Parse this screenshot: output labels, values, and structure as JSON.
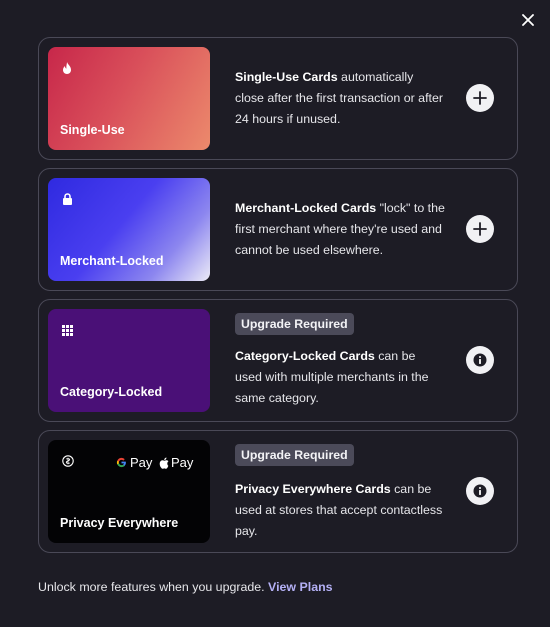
{
  "close_label": "close",
  "cards": [
    {
      "card_label": "Single-Use",
      "title": "Single-Use Cards",
      "description": " automatically close after the first transaction or after 24 hours if unused.",
      "icon": "flame-icon",
      "action": "add-icon"
    },
    {
      "card_label": "Merchant-Locked",
      "title": "Merchant-Locked Cards",
      "description": " \"lock\" to the first merchant where they're used and cannot be used elsewhere.",
      "icon": "lock-icon",
      "action": "add-icon"
    },
    {
      "card_label": "Category-Locked",
      "badge": "Upgrade Required",
      "title": "Category-Locked Cards",
      "description": " can be used with multiple merchants in the same category.",
      "icon": "grid-icon",
      "action": "info-icon"
    },
    {
      "card_label": "Privacy Everywhere",
      "badge": "Upgrade Required",
      "title": "Privacy Everywhere Cards",
      "description": " can be used at stores that accept contactless pay.",
      "icon": "privacy-coin-icon",
      "google_pay": "Pay",
      "apple_pay": "Pay",
      "action": "info-icon"
    }
  ],
  "footer": {
    "text": "Unlock more features when you upgrade. ",
    "link": "View Plans"
  }
}
